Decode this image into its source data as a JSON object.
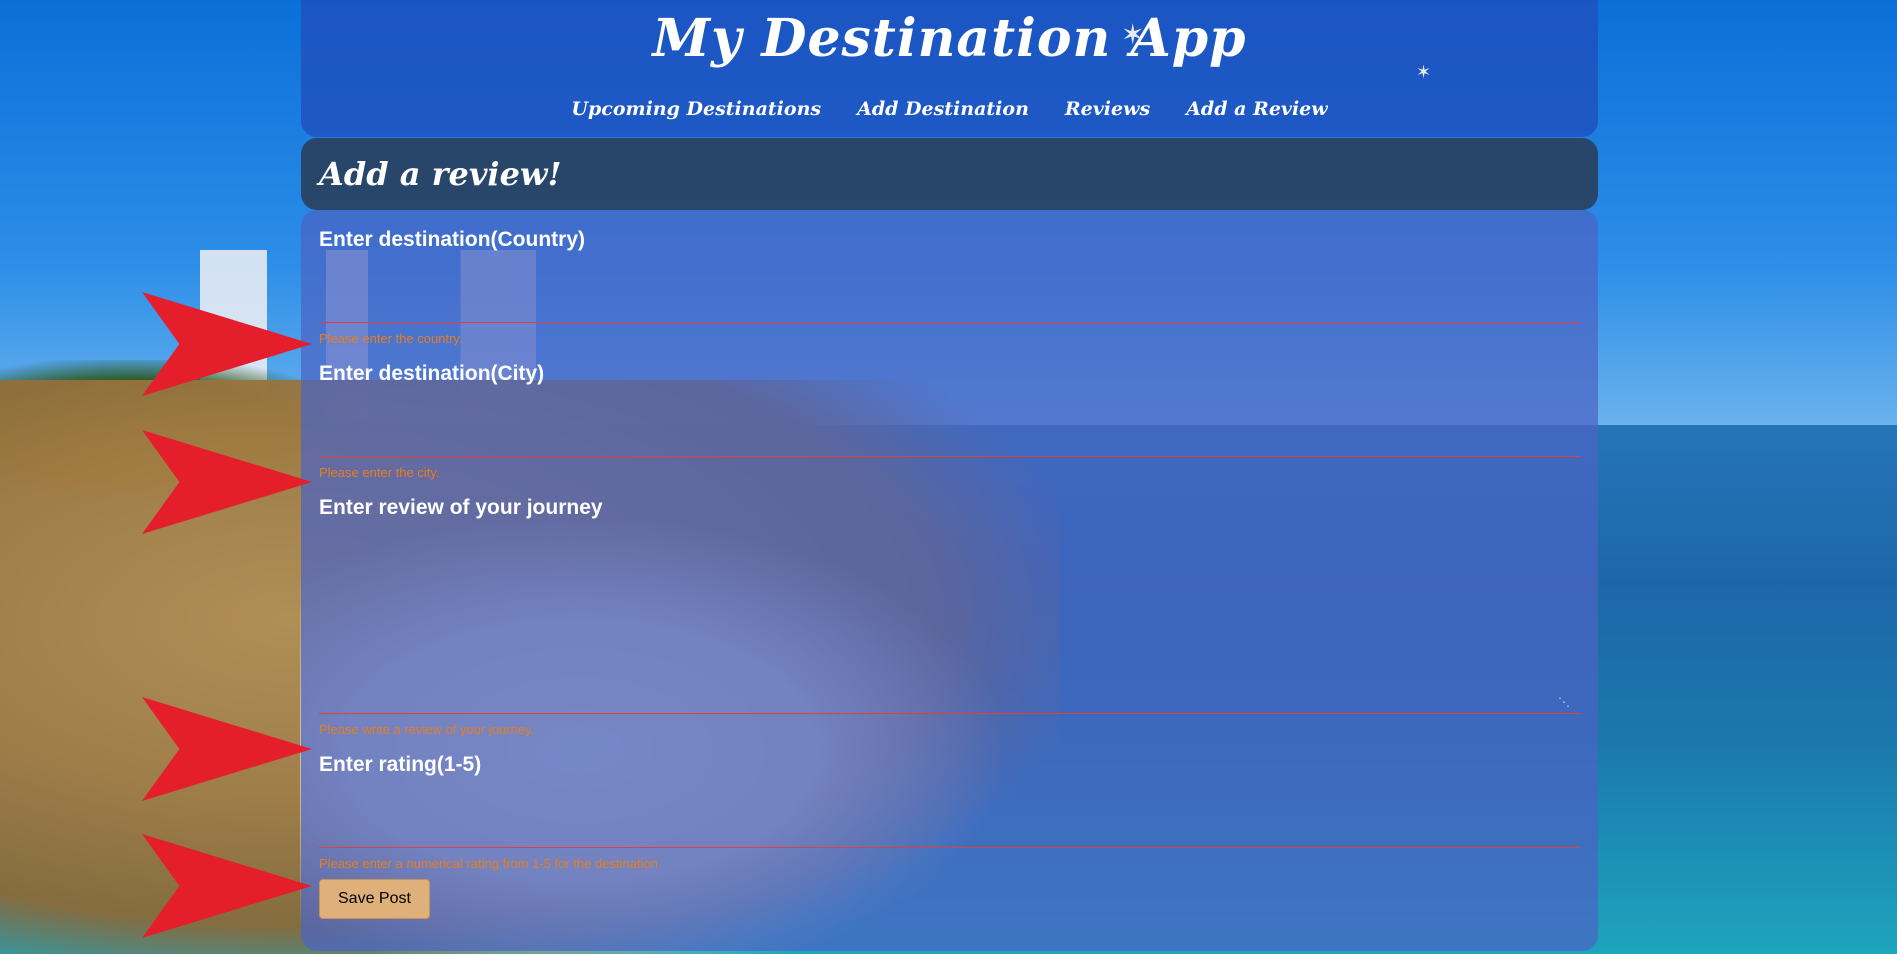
{
  "app": {
    "title": "My Destination App"
  },
  "nav": {
    "items": [
      {
        "label": "Upcoming Destinations"
      },
      {
        "label": "Add Destination"
      },
      {
        "label": "Reviews"
      },
      {
        "label": "Add a Review"
      }
    ]
  },
  "banner": {
    "title": "Add a review!"
  },
  "form": {
    "country": {
      "label": "Enter destination(Country)",
      "value": "",
      "error": "Please enter the country."
    },
    "city": {
      "label": "Enter destination(City)",
      "value": "",
      "error": "Please enter the city."
    },
    "review": {
      "label": "Enter review of your journey",
      "value": "",
      "error": "Please write a review of your journey."
    },
    "rating": {
      "label": "Enter rating(1-5)",
      "value": "",
      "error": "Please enter a numerical rating from 1-5 for the destination"
    },
    "save_label": "Save Post"
  },
  "colors": {
    "header_bg": "#1e50be",
    "banner_bg": "#28415f",
    "error_text": "#e67e22",
    "field_underline": "#e0403a",
    "save_button": "#e0b07a",
    "arrow": "#e41e2a"
  }
}
